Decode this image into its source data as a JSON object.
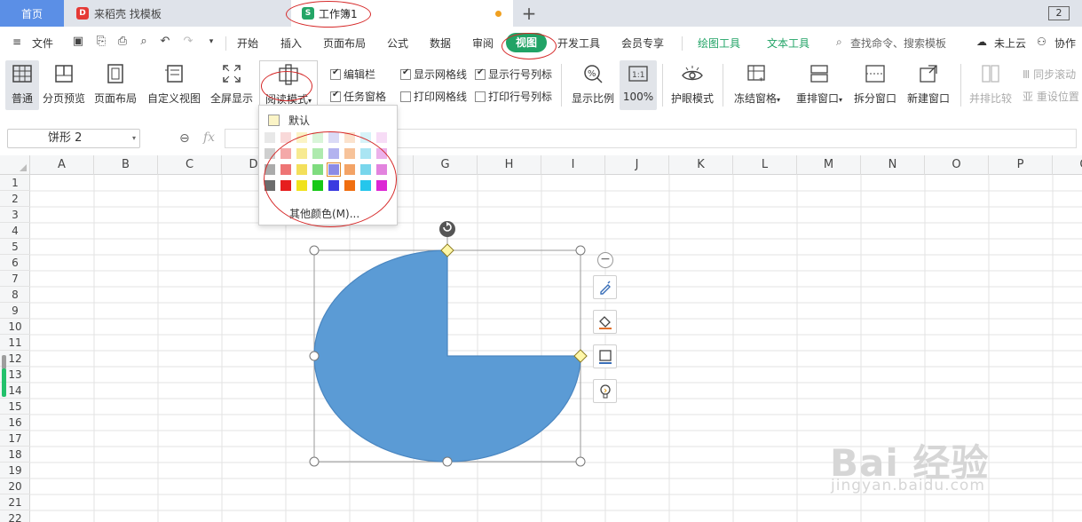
{
  "tabs": {
    "home": "首页",
    "doc": "来稻壳 找模板",
    "active": "工作簿1",
    "plus": "+",
    "window_count": "2"
  },
  "menu": {
    "file": "文件",
    "items": [
      "开始",
      "插入",
      "页面布局",
      "公式",
      "数据",
      "审阅",
      "视图",
      "开发工具",
      "会员专享"
    ],
    "active": "视图",
    "draw_tools": "绘图工具",
    "text_tools": "文本工具",
    "search": "查找命令、搜索模板",
    "cloud": "未上云",
    "collab": "协作"
  },
  "ribbon": {
    "normal": "普通",
    "page_break": "分页预览",
    "page_layout": "页面布局",
    "custom_view": "自定义视图",
    "fullscreen": "全屏显示",
    "reading_mode": "阅读模式",
    "edit_bar": "编辑栏",
    "task_pane": "任务窗格",
    "show_gridlines": "显示网格线",
    "print_gridlines": "打印网格线",
    "show_headers": "显示行号列标",
    "print_headers": "打印行号列标",
    "zoom_ratio": "显示比例",
    "zoom_100": "100%",
    "eye_mode": "护眼模式",
    "freeze": "冻结窗格",
    "arrange": "重排窗口",
    "split": "拆分窗口",
    "new_window": "新建窗口",
    "side_by_side": "并排比较",
    "sync_scroll": "同步滚动",
    "reset_pos": "重设位置"
  },
  "formula_bar": {
    "name_box": "饼形 2",
    "fx": "fx"
  },
  "columns": [
    "A",
    "B",
    "C",
    "D",
    "E",
    "F",
    "G",
    "H",
    "I",
    "J",
    "K",
    "L",
    "M",
    "N",
    "O",
    "P",
    "Q"
  ],
  "rows": [
    "1",
    "2",
    "3",
    "4",
    "5",
    "6",
    "7",
    "8",
    "9",
    "10",
    "11",
    "12",
    "13",
    "14",
    "15",
    "16",
    "17",
    "18",
    "19",
    "20",
    "21",
    "22"
  ],
  "dropdown": {
    "default_label": "默认",
    "more_colors": "其他颜色(M)...",
    "palette": [
      [
        "#e8e8e8",
        "#f9d9d9",
        "#fbf3c5",
        "#d9f5d9",
        "#dadaf6",
        "#fbe2cd",
        "#d7f3f9",
        "#f7dcf6"
      ],
      [
        "#cfcfcf",
        "#f4a9a9",
        "#f7ea91",
        "#aeeaae",
        "#b3b3ef",
        "#f7c39a",
        "#aae5f3",
        "#ecb1ea"
      ],
      [
        "#ababab",
        "#ee7575",
        "#f3df5b",
        "#7fdc7f",
        "#8b8be6",
        "#f3a366",
        "#79d6ec",
        "#e283de"
      ],
      [
        "#6c6c6c",
        "#e61e1e",
        "#f0e21c",
        "#17c817",
        "#3b3be0",
        "#f06e10",
        "#25c6ec",
        "#dc26d4"
      ]
    ],
    "selected": [
      2,
      4
    ]
  },
  "shape": {
    "fill": "#5b9bd5",
    "stroke": "#4a86c0"
  },
  "watermark": {
    "main": "Bai 经验",
    "sub": "jingyan.baidu.com"
  },
  "colors": {
    "accent": "#21a366",
    "tab_home": "#5b8fe6",
    "annotation": "#d62828"
  }
}
